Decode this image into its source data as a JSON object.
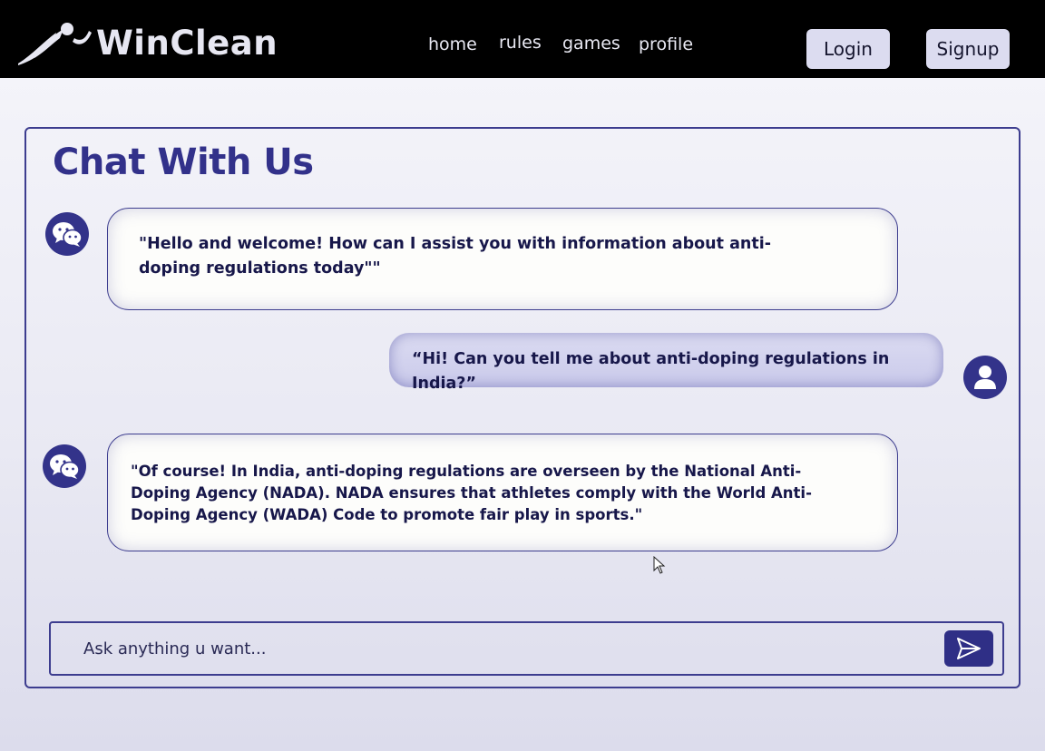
{
  "brand": {
    "name": "WinClean"
  },
  "nav": {
    "items": [
      {
        "label": "home"
      },
      {
        "label": "rules"
      },
      {
        "label": "games"
      },
      {
        "label": "profile"
      }
    ]
  },
  "auth": {
    "login_label": "Login",
    "signup_label": "Signup"
  },
  "chat": {
    "title": "Chat With Us",
    "messages": [
      {
        "sender": "bot",
        "icon": "wechat-icon",
        "text": "\"Hello and welcome! How can I assist you with information about anti-doping regulations today\"\""
      },
      {
        "sender": "user",
        "icon": "user-icon",
        "text": "“Hi! Can you tell me about anti-doping regulations in India?”"
      },
      {
        "sender": "bot",
        "icon": "wechat-icon",
        "text": "\"Of course! In India, anti-doping regulations are overseen by the National Anti-Doping Agency (NADA). NADA ensures that athletes comply with the World Anti-Doping Agency (WADA) Code to promote fair play in sports.\""
      }
    ],
    "input": {
      "placeholder": "Ask anything u want...",
      "value": ""
    },
    "send_icon": "send-icon"
  },
  "colors": {
    "accent": "#33338a",
    "header_bg": "#000000",
    "auth_button_bg": "#dcdcf0",
    "user_bubble": "#cfcfec"
  }
}
